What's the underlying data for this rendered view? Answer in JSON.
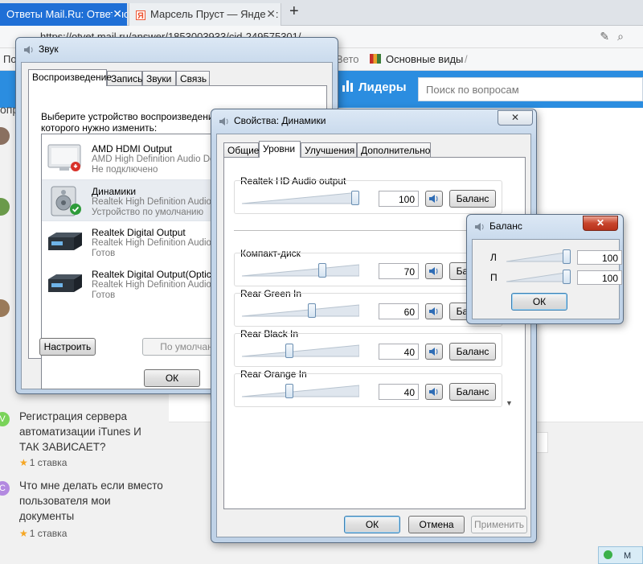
{
  "browser": {
    "tabs": [
      {
        "label": "Ответы Mail.Ru: Ответ по"
      },
      {
        "label": "Марсель Пруст — Яндекс: н"
      }
    ],
    "new_tab": "+",
    "tab_close": "✕",
    "address": "https://otvet.mail.ru/answer/1853003933/cid-249575301/",
    "bookmarks": {
      "left": "По",
      "right_prefix": "Вето",
      "item": "Основные виды",
      "slash": "/"
    }
  },
  "site": {
    "leaders": "Лидеры",
    "search_placeholder": "Поиск по вопросам",
    "left_letter": "опр",
    "questions": [
      {
        "title": "Регистрация сервера автоматизации iTunes И ТАК ЗАВИСАЕТ?",
        "meta": "1 ставка",
        "badge": "V"
      },
      {
        "title": "Что мне делать если вместо пользователя мои документы",
        "meta": "1 ставка",
        "badge": "C"
      }
    ],
    "taskbar_chip": "М"
  },
  "sound_window": {
    "title": "Звук",
    "tabs": [
      "Воспроизведение",
      "Запись",
      "Звуки",
      "Связь"
    ],
    "description": "Выберите устройство воспроизведения, параметры которого нужно изменить:",
    "devices": [
      {
        "name": "AMD HDMI Output",
        "driver": "AMD High Definition Audio De",
        "status": "Не подключено"
      },
      {
        "name": "Динамики",
        "driver": "Realtek High Definition Audio",
        "status": "Устройство по умолчанию"
      },
      {
        "name": "Realtek Digital Output",
        "driver": "Realtek High Definition Audio",
        "status": "Готов"
      },
      {
        "name": "Realtek Digital Output(Optical",
        "driver": "Realtek High Definition Audio",
        "status": "Готов"
      }
    ],
    "configure_btn": "Настроить",
    "default_btn": "По умолчан",
    "ok_btn": "ОК"
  },
  "props_window": {
    "title": "Свойства: Динамики",
    "tabs": [
      "Общие",
      "Уровни",
      "Улучшения",
      "Дополнительно"
    ],
    "balance_label": "Баланс",
    "levels": [
      {
        "name": "Realtek HD Audio output",
        "value": "100",
        "level": 100
      },
      {
        "name": "Компакт-диск",
        "value": "70",
        "level": 70
      },
      {
        "name": "Rear Green In",
        "value": "60",
        "level": 60
      },
      {
        "name": "Rear Black In",
        "value": "40",
        "level": 40
      },
      {
        "name": "Rear Orange In",
        "value": "40",
        "level": 40
      }
    ],
    "ok_btn": "ОК",
    "cancel_btn": "Отмена",
    "apply_btn": "Применить"
  },
  "balance_window": {
    "title": "Баланс",
    "channels": [
      {
        "label": "Л",
        "value": "100",
        "level": 100
      },
      {
        "label": "П",
        "value": "100",
        "level": 100
      }
    ],
    "ok_btn": "ОК"
  },
  "colors": {
    "tab_active": "#1f6fd6",
    "site_bar": "#2b8de0",
    "close_red": "#c8452c"
  }
}
